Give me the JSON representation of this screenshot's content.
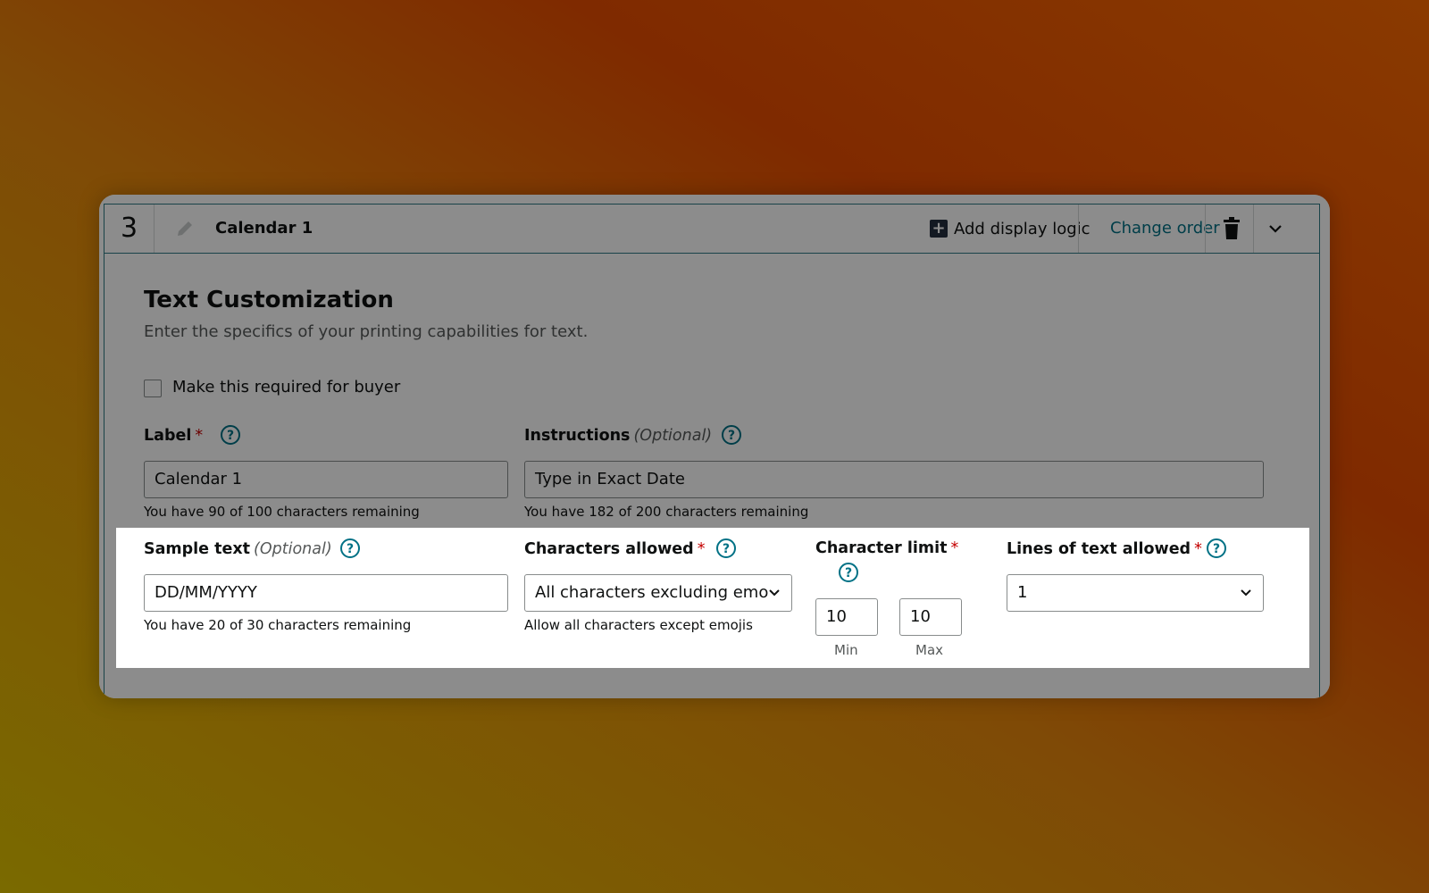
{
  "header": {
    "step_number": "3",
    "field_title": "Calendar 1",
    "add_logic_label": "Add display logic",
    "change_order_label": "Change order"
  },
  "section": {
    "title": "Text Customization",
    "description": "Enter the specifics of your printing capabilities for text."
  },
  "required_checkbox": {
    "label": "Make this required for buyer",
    "checked": false
  },
  "label_field": {
    "label": "Label",
    "required_mark": "*",
    "value": "Calendar 1",
    "hint": "You have 90 of 100 characters remaining"
  },
  "instructions_field": {
    "label": "Instructions",
    "optional": "(Optional)",
    "value": "Type in Exact Date",
    "hint": "You have 182 of 200 characters remaining"
  },
  "sample_text_field": {
    "label": "Sample text",
    "optional": "(Optional)",
    "value": "DD/MM/YYYY",
    "hint": "You have 20 of 30 characters remaining"
  },
  "characters_allowed": {
    "label": "Characters allowed",
    "required_mark": "*",
    "selected": "All characters excluding emo",
    "hint": "Allow all characters except emojis"
  },
  "character_limit": {
    "label": "Character limit",
    "required_mark": "*",
    "min_value": "10",
    "max_value": "10",
    "min_label": "Min",
    "max_label": "Max"
  },
  "lines_allowed": {
    "label": "Lines of text allowed",
    "required_mark": "*",
    "selected": "1"
  },
  "colors": {
    "accent_teal": "#007185",
    "border_teal": "#2f7a85",
    "required_red": "#c40000",
    "dark_navy": "#232f3e"
  }
}
